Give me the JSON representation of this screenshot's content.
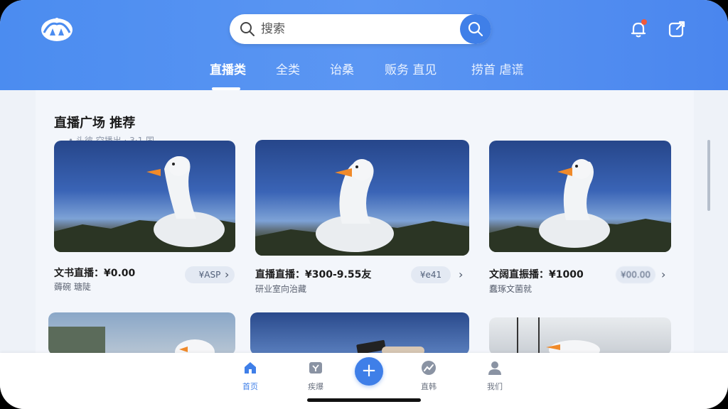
{
  "header": {
    "search": {
      "placeholder": "搜索"
    },
    "tabs": [
      {
        "label": "直播类",
        "active": true
      },
      {
        "label": "全类",
        "active": false
      },
      {
        "label": "诒桑",
        "active": false
      },
      {
        "label": "贩务  直见",
        "active": false
      },
      {
        "label": "捞首 虐谎",
        "active": false
      }
    ],
    "icons": [
      "logo-mark",
      "search-icon",
      "bell-icon",
      "share-icon"
    ],
    "notification_dot": true
  },
  "section": {
    "title": "直播广场 推荐",
    "faint_text": "• 头彼 空播出 · 3·1 国"
  },
  "cards": [
    {
      "title": "文书直播：¥0.00",
      "subtitle": "薅碗 瑭陡",
      "pill": "¥ASP"
    },
    {
      "title": "直播直播：¥300-9.55友",
      "subtitle": "研业室向治藏",
      "pill": "¥e41"
    },
    {
      "title": "文阔直振播：¥1000",
      "subtitle": "蠢琢文菌就",
      "pill": "¥00.00"
    }
  ],
  "bottom_nav": {
    "items": [
      {
        "label": "首页",
        "icon": "home-icon",
        "active": true
      },
      {
        "label": "疾爆",
        "icon": "discover-icon",
        "active": false
      },
      {
        "label": "",
        "icon": "plus-icon",
        "active": false
      },
      {
        "label": "直韩",
        "icon": "trend-icon",
        "active": false
      },
      {
        "label": "我们",
        "icon": "profile-icon",
        "active": false
      }
    ]
  },
  "colors": {
    "brand": "#3f7fe8",
    "header_gradient_start": "#4b8cf0",
    "header_gradient_end": "#4a86ee",
    "badge": "#f05a3c"
  }
}
